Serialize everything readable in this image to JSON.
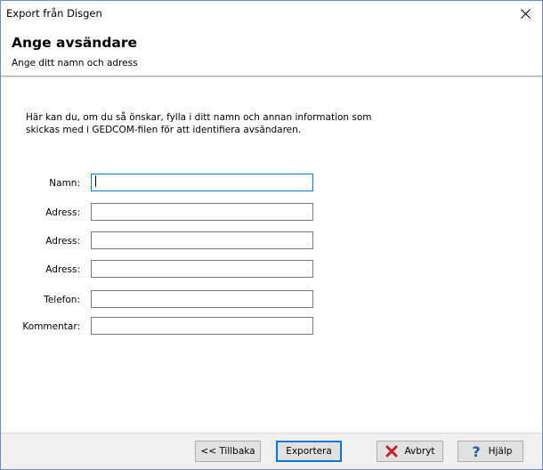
{
  "window": {
    "title": "Export från Disgen"
  },
  "header": {
    "title": "Ange avsändare",
    "subtitle": "Ange ditt namn och adress"
  },
  "intro": "Här kan du, om du så önskar, fylla i ditt namn och annan information som skickas med i GEDCOM-filen för att identifiera avsändaren.",
  "fields": [
    {
      "label": "Namn:",
      "value": ""
    },
    {
      "label": "Adress:",
      "value": ""
    },
    {
      "label": "Adress:",
      "value": ""
    },
    {
      "label": "Adress:",
      "value": ""
    },
    {
      "label": "Telefon:",
      "value": ""
    },
    {
      "label": "Kommentar:",
      "value": ""
    }
  ],
  "buttons": {
    "back": "<< Tillbaka",
    "export": "Exportera",
    "cancel": "Avbryt",
    "help": "Hjälp"
  },
  "colors": {
    "accent": "#0078d7",
    "cancel_icon": "#c0262c",
    "help_icon": "#1e5aa8"
  }
}
